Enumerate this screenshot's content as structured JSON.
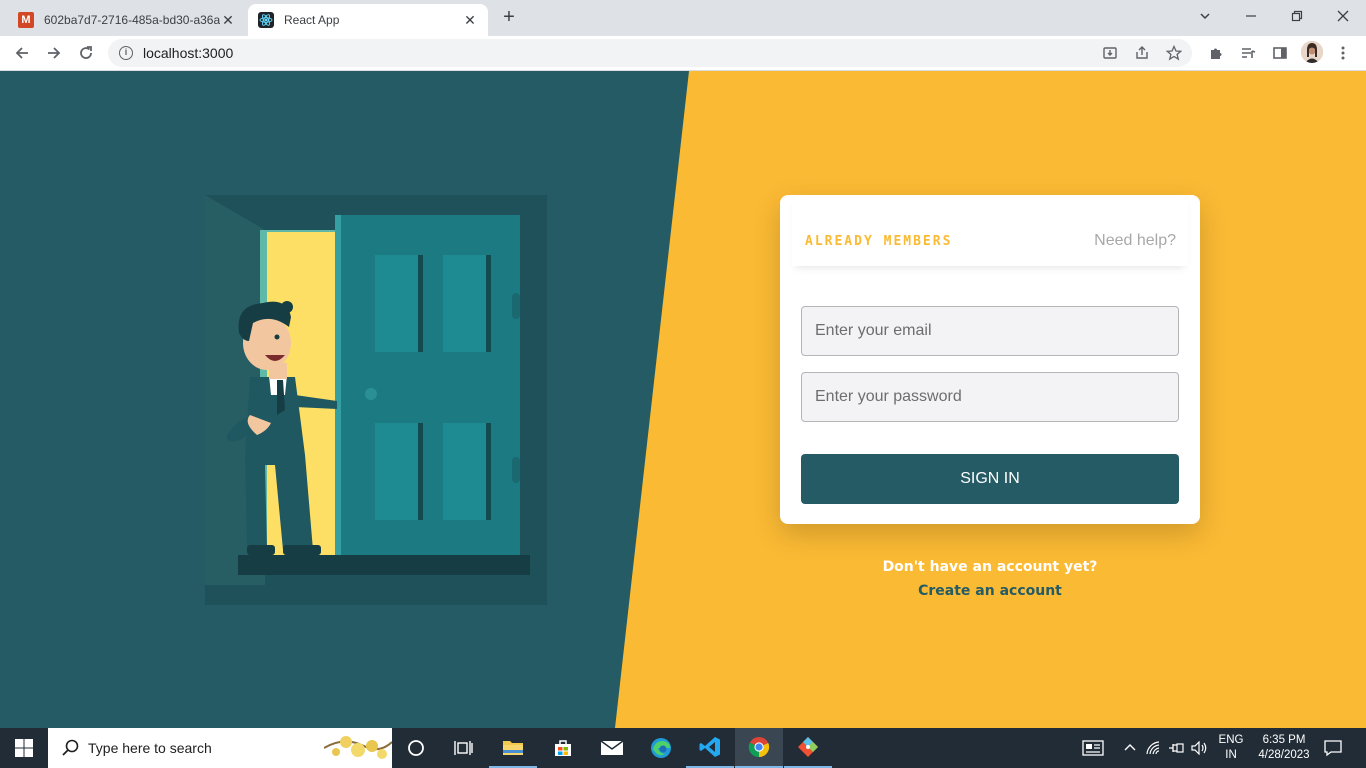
{
  "browser": {
    "tabs": [
      {
        "title": "602ba7d7-2716-485a-bd30-a36a",
        "favicon": "m-icon",
        "active": false
      },
      {
        "title": "React App",
        "favicon": "react-icon",
        "active": true
      }
    ],
    "new_tab_symbol": "+",
    "address": "localhost:3000"
  },
  "page": {
    "colors": {
      "teal": "#245b64",
      "yellow": "#fbba34",
      "white": "#ffffff"
    },
    "login_card": {
      "heading": "ALREADY MEMBERS",
      "help_link": "Need help?",
      "email_placeholder": "Enter your email",
      "password_placeholder": "Enter your password",
      "submit_label": "SIGN IN"
    },
    "signup": {
      "prompt": "Don't have an account yet?",
      "link": "Create an account"
    }
  },
  "taskbar": {
    "search_placeholder": "Type here to search",
    "apps": [
      "cortana-icon",
      "task-view-icon",
      "file-explorer-icon",
      "store-icon",
      "mail-icon",
      "edge-icon",
      "vscode-icon",
      "chrome-icon",
      "git-icon"
    ],
    "language": {
      "line1": "ENG",
      "line2": "IN"
    },
    "time": "6:35 PM",
    "date": "4/28/2023"
  }
}
